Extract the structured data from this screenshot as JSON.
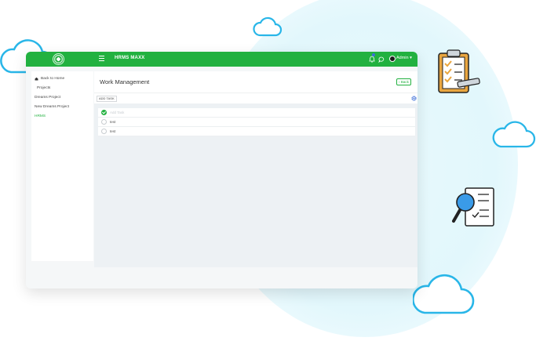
{
  "topbar": {
    "brand": "HRMS MAXX",
    "user_label": "Admin ▾",
    "icons": [
      "logo",
      "hamburger-icon",
      "bell-icon",
      "chat-icon",
      "avatar"
    ]
  },
  "sidebar": {
    "items": [
      {
        "label": "Back to Home",
        "icon": "home-icon"
      },
      {
        "label": "Projects"
      },
      {
        "label": "Dreams Project"
      },
      {
        "label": "New Dreams Project"
      },
      {
        "label": "HRMS",
        "active": true
      }
    ]
  },
  "main": {
    "title": "Work Management",
    "back_label": "‹ Back",
    "add_task_label": "ADD TASK",
    "tasks": [
      {
        "label": "Add Task",
        "done": true
      },
      {
        "label": "test",
        "done": false
      },
      {
        "label": "test",
        "done": false
      }
    ]
  },
  "colors": {
    "accent": "#22b140",
    "background": "#edf1f4",
    "cloud": "#29b6e8"
  }
}
